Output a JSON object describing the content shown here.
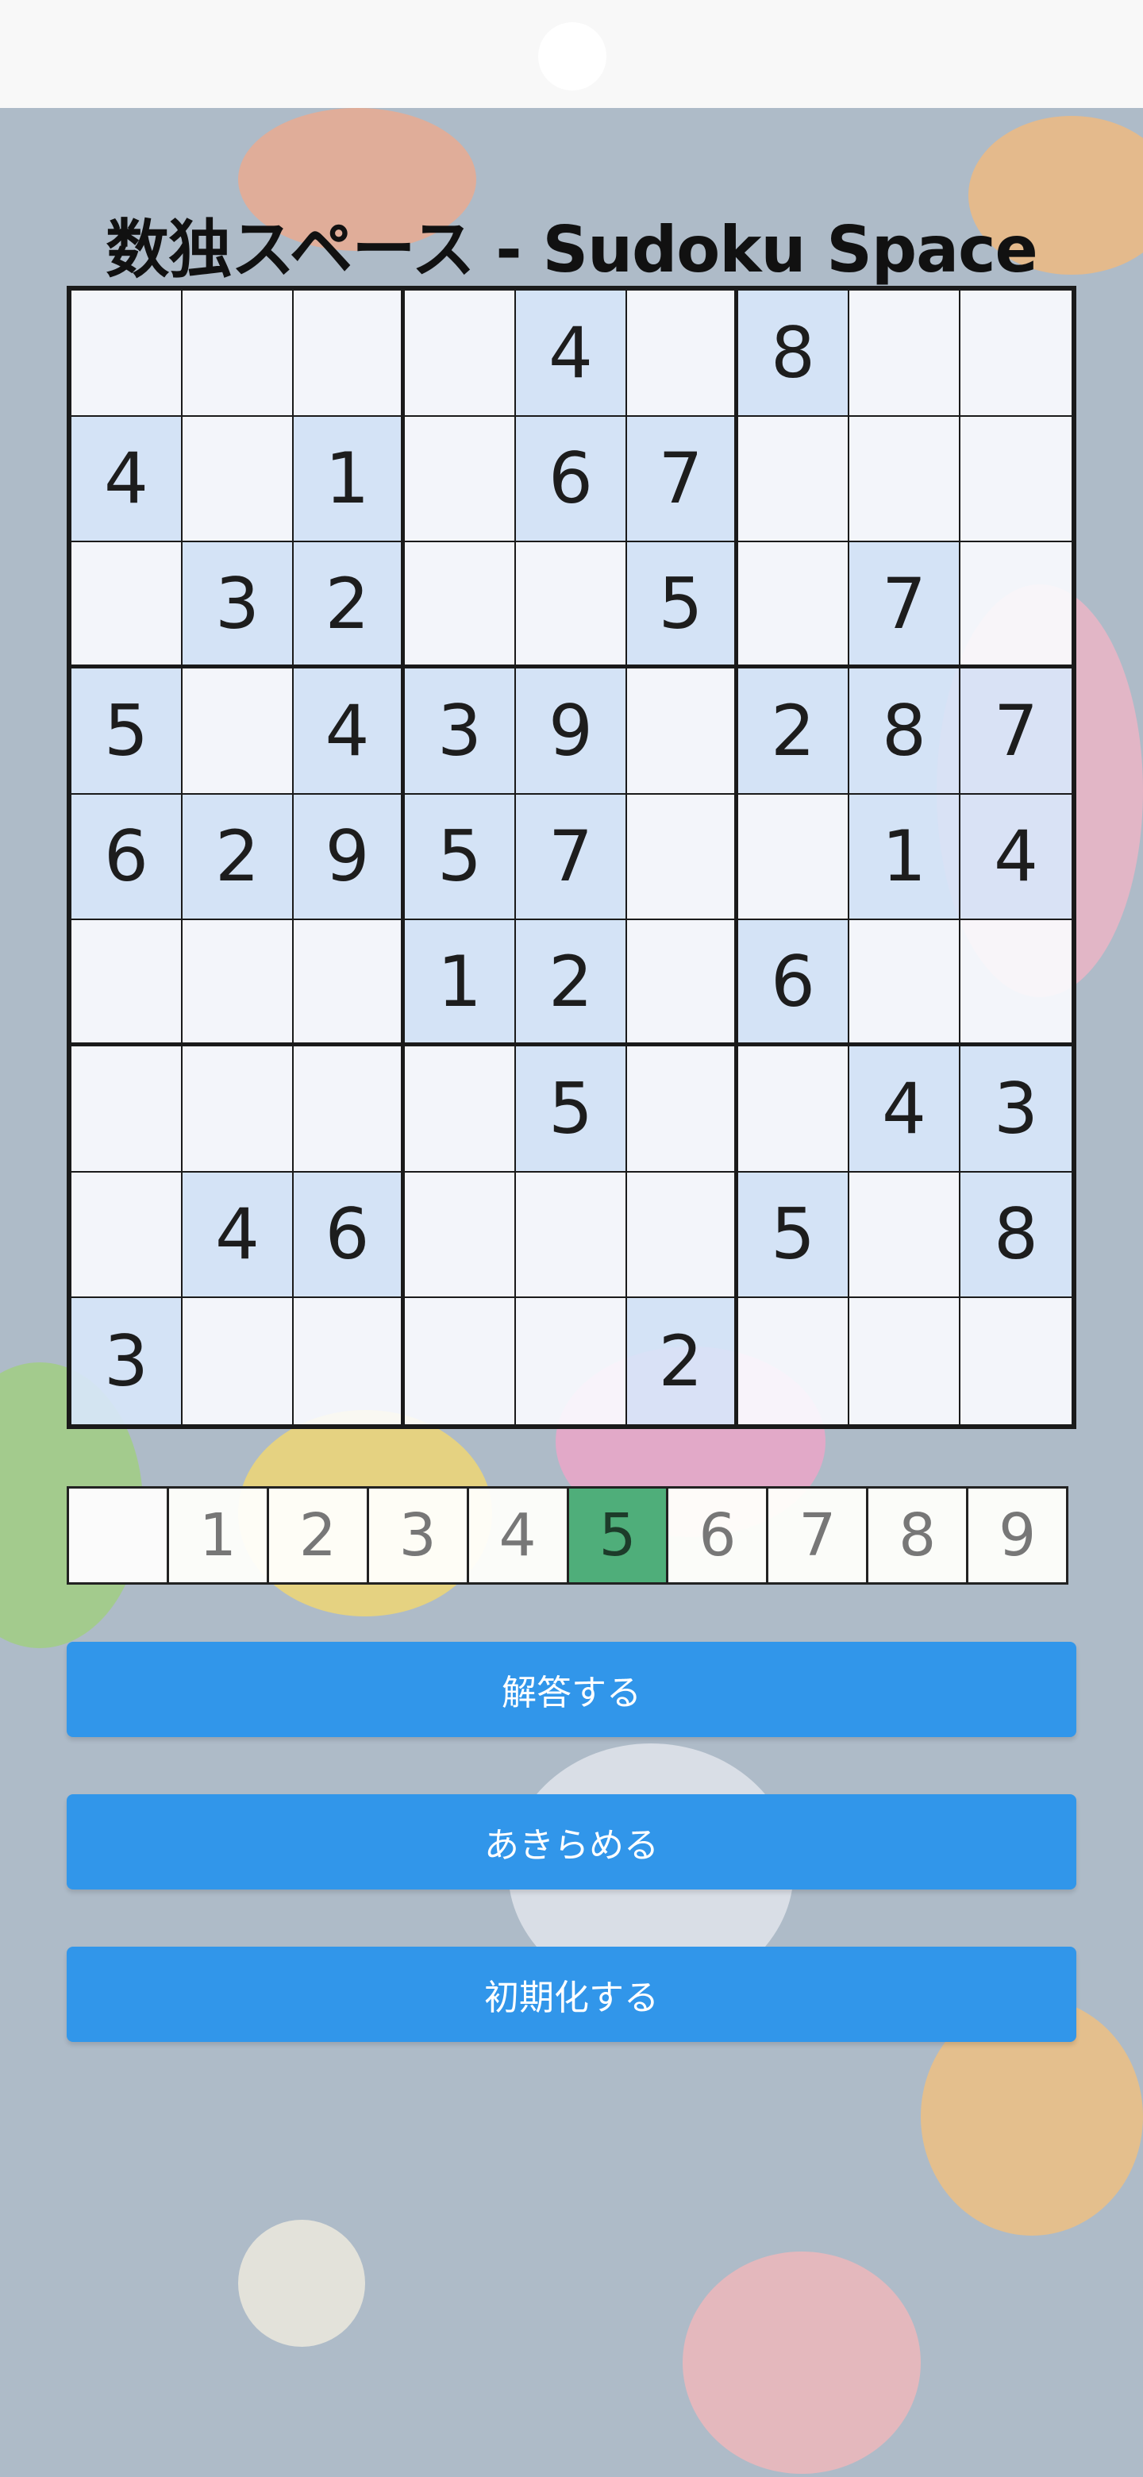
{
  "title": "数独スペース - Sudoku Space",
  "grid": [
    [
      "",
      "",
      "",
      "",
      "4",
      "",
      "8",
      "",
      ""
    ],
    [
      "4",
      "",
      "1",
      "",
      "6",
      "7",
      "",
      "",
      ""
    ],
    [
      "",
      "3",
      "2",
      "",
      "",
      "5",
      "",
      "7",
      ""
    ],
    [
      "5",
      "",
      "4",
      "3",
      "9",
      "",
      "2",
      "8",
      "7"
    ],
    [
      "6",
      "2",
      "9",
      "5",
      "7",
      "",
      "",
      "1",
      "4"
    ],
    [
      "",
      "",
      "",
      "1",
      "2",
      "",
      "6",
      "",
      ""
    ],
    [
      "",
      "",
      "",
      "",
      "5",
      "",
      "",
      "4",
      "3"
    ],
    [
      "",
      "4",
      "6",
      "",
      "",
      "",
      "5",
      "",
      "8"
    ],
    [
      "3",
      "",
      "",
      "",
      "",
      "2",
      "",
      "",
      ""
    ]
  ],
  "numpad": {
    "keys": [
      "",
      "1",
      "2",
      "3",
      "4",
      "5",
      "6",
      "7",
      "8",
      "9"
    ],
    "selected": "5"
  },
  "buttons": {
    "submit": "解答する",
    "give_up": "あきらめる",
    "reset": "初期化する"
  },
  "colors": {
    "button": "#3196ea",
    "selected_key": "#4fae7a",
    "given_cell": "#d7e6fa"
  }
}
